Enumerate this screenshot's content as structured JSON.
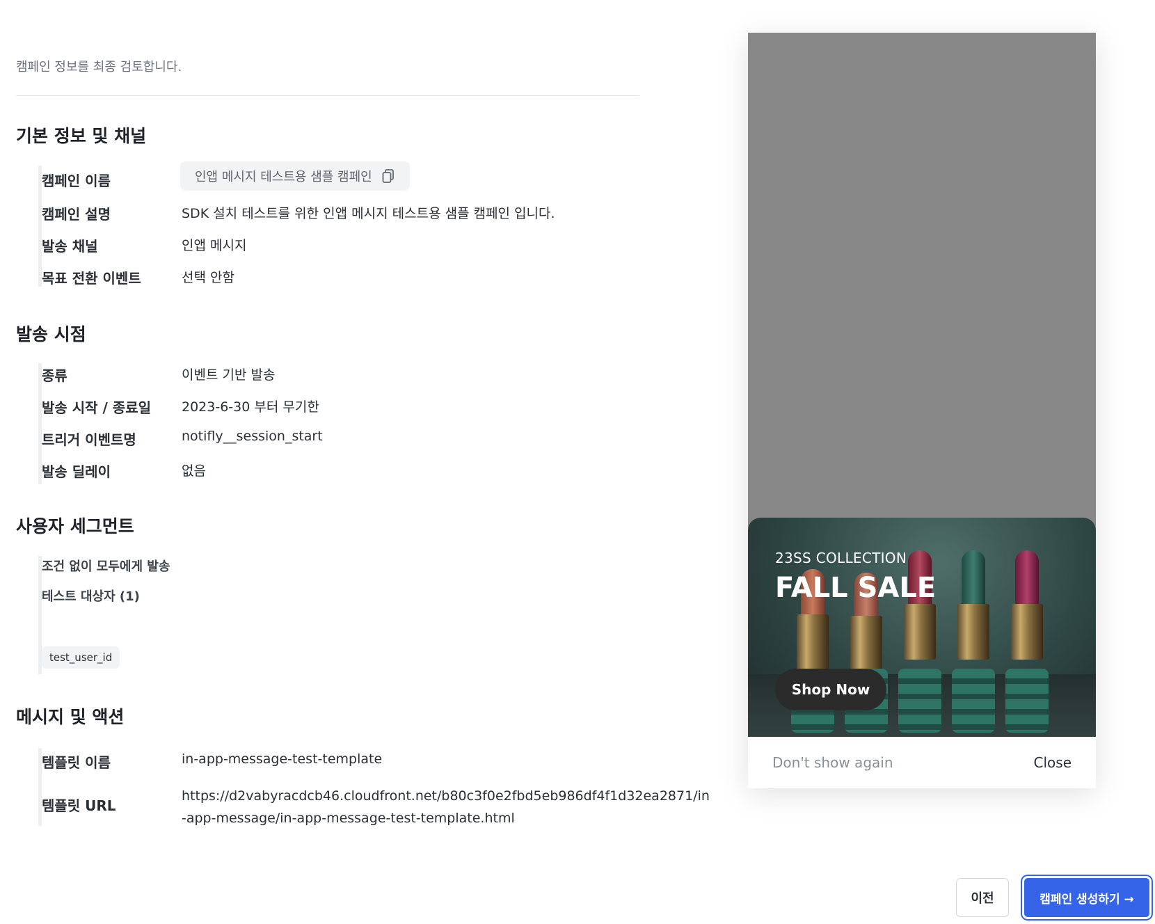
{
  "header": {
    "subtitle": "캠페인 정보를 최종 검토합니다."
  },
  "basic": {
    "title": "기본 정보 및 채널",
    "name_label": "캠페인 이름",
    "name_value": "인앱 메시지 테스트용 샘플 캠페인",
    "desc_label": "캠페인 설명",
    "desc_value": "SDK 설치 테스트를 위한 인앱 메시지 테스트용 샘플 캠페인 입니다.",
    "channel_label": "발송 채널",
    "channel_value": "인앱 메시지",
    "goal_label": "목표 전환 이벤트",
    "goal_value": "선택 안함"
  },
  "timing": {
    "title": "발송 시점",
    "type_label": "종류",
    "type_value": "이벤트 기반 발송",
    "period_label": "발송 시작 / 종료일",
    "period_value": "2023-6-30 부터 무기한",
    "trigger_label": "트리거 이벤트명",
    "trigger_value": "notifly__session_start",
    "delay_label": "발송 딜레이",
    "delay_value": "없음"
  },
  "segment": {
    "title": "사용자 세그먼트",
    "all_text": "조건 없이 모두에게 발송",
    "test_label": "테스트 대상자 (1)",
    "test_user": "test_user_id"
  },
  "message": {
    "title": "메시지 및 액션",
    "template_name_label": "템플릿 이름",
    "template_name_value": "in-app-message-test-template",
    "template_url_label": "템플릿 URL",
    "template_url_value": "https://d2vabyracdcb46.cloudfront.net/b80c3f0e2fbd5eb986df4f1d32ea2871/in-app-message/in-app-message-test-template.html"
  },
  "preview": {
    "collection": "23SS COLLECTION",
    "headline": "FALL SALE",
    "cta": "Shop Now",
    "dont_show": "Don't show again",
    "close": "Close"
  },
  "actions": {
    "prev": "이전",
    "create": "캠페인 생성하기 →"
  },
  "colors": {
    "primary": "#3564e8",
    "phone_bg": "#878787"
  }
}
